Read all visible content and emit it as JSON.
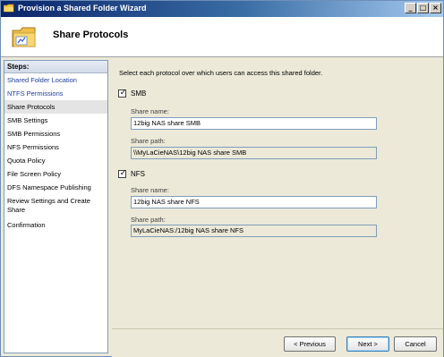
{
  "window": {
    "title": "Provision a Shared Folder Wizard",
    "controls": {
      "minimize": "_",
      "maximize": "□",
      "close": "×"
    }
  },
  "header": {
    "title": "Share Protocols",
    "icon": "share-folder-icon"
  },
  "steps": {
    "heading": "Steps:",
    "items": [
      {
        "label": "Shared Folder Location",
        "state": "link"
      },
      {
        "label": "NTFS Permissions",
        "state": "link"
      },
      {
        "label": "Share Protocols",
        "state": "current"
      },
      {
        "label": "SMB Settings",
        "state": "plain"
      },
      {
        "label": "SMB Permissions",
        "state": "plain"
      },
      {
        "label": "NFS Permissions",
        "state": "plain"
      },
      {
        "label": "Quota Policy",
        "state": "plain"
      },
      {
        "label": "File Screen Policy",
        "state": "plain"
      },
      {
        "label": "DFS Namespace Publishing",
        "state": "plain"
      },
      {
        "label": "Review Settings and Create Share",
        "state": "plain"
      },
      {
        "label": "Confirmation",
        "state": "plain"
      }
    ]
  },
  "content": {
    "instruction": "Select each protocol over which users can access this shared folder.",
    "smb": {
      "label": "SMB",
      "checked": true,
      "share_name_label": "Share name:",
      "share_name_value": "12big NAS share SMB",
      "share_path_label": "Share path:",
      "share_path_value": "\\\\MyLaCieNAS\\12big NAS share SMB"
    },
    "nfs": {
      "label": "NFS",
      "checked": true,
      "share_name_label": "Share name:",
      "share_name_value": "12big NAS share NFS",
      "share_path_label": "Share path:",
      "share_path_value": "MyLaCieNAS:/12big NAS share NFS"
    }
  },
  "buttons": {
    "previous": "< Previous",
    "next": "Next >",
    "cancel": "Cancel"
  },
  "colors": {
    "titlebar_start": "#0a246a",
    "titlebar_end": "#a6caf0",
    "link": "#1f3da0",
    "dialog_bg": "#ece9d8"
  }
}
